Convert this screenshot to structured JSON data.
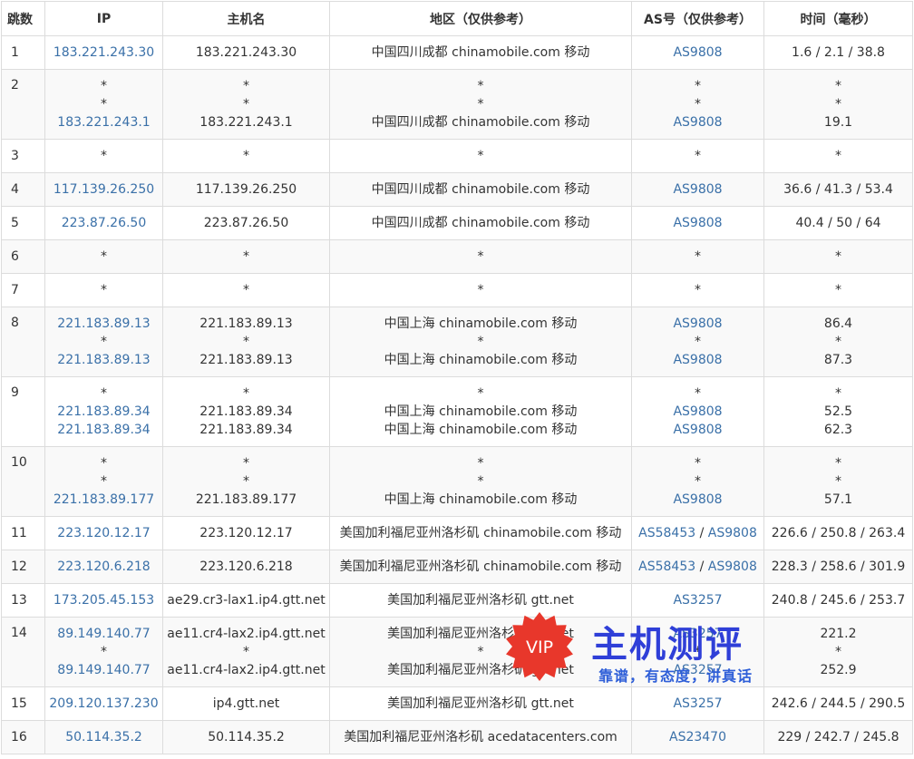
{
  "headers": [
    "跳数",
    "IP",
    "主机名",
    "地区（仅供参考）",
    "AS号（仅供参考）",
    "时间（毫秒）"
  ],
  "rows": [
    {
      "hop": "1",
      "lines": [
        {
          "ip": "183.221.243.30",
          "host": "183.221.243.30",
          "region": "中国四川成都 chinamobile.com 移动",
          "as": [
            "AS9808"
          ],
          "time": "1.6 / 2.1 / 38.8"
        }
      ]
    },
    {
      "hop": "2",
      "lines": [
        {
          "ip": "*",
          "host": "*",
          "region": "*",
          "as": [
            "*"
          ],
          "time": "*"
        },
        {
          "ip": "*",
          "host": "*",
          "region": "*",
          "as": [
            "*"
          ],
          "time": "*"
        },
        {
          "ip": "183.221.243.1",
          "host": "183.221.243.1",
          "region": "中国四川成都 chinamobile.com 移动",
          "as": [
            "AS9808"
          ],
          "time": "19.1"
        }
      ]
    },
    {
      "hop": "3",
      "lines": [
        {
          "ip": "*",
          "host": "*",
          "region": "*",
          "as": [
            "*"
          ],
          "time": "*"
        }
      ]
    },
    {
      "hop": "4",
      "lines": [
        {
          "ip": "117.139.26.250",
          "host": "117.139.26.250",
          "region": "中国四川成都 chinamobile.com 移动",
          "as": [
            "AS9808"
          ],
          "time": "36.6 / 41.3 / 53.4"
        }
      ]
    },
    {
      "hop": "5",
      "lines": [
        {
          "ip": "223.87.26.50",
          "host": "223.87.26.50",
          "region": "中国四川成都 chinamobile.com 移动",
          "as": [
            "AS9808"
          ],
          "time": "40.4 / 50 / 64"
        }
      ]
    },
    {
      "hop": "6",
      "lines": [
        {
          "ip": "*",
          "host": "*",
          "region": "*",
          "as": [
            "*"
          ],
          "time": "*"
        }
      ]
    },
    {
      "hop": "7",
      "lines": [
        {
          "ip": "*",
          "host": "*",
          "region": "*",
          "as": [
            "*"
          ],
          "time": "*"
        }
      ]
    },
    {
      "hop": "8",
      "lines": [
        {
          "ip": "221.183.89.13",
          "host": "221.183.89.13",
          "region": "中国上海 chinamobile.com 移动",
          "as": [
            "AS9808"
          ],
          "time": "86.4"
        },
        {
          "ip": "*",
          "host": "*",
          "region": "*",
          "as": [
            "*"
          ],
          "time": "*"
        },
        {
          "ip": "221.183.89.13",
          "host": "221.183.89.13",
          "region": "中国上海 chinamobile.com 移动",
          "as": [
            "AS9808"
          ],
          "time": "87.3"
        }
      ]
    },
    {
      "hop": "9",
      "lines": [
        {
          "ip": "*",
          "host": "*",
          "region": "*",
          "as": [
            "*"
          ],
          "time": "*"
        },
        {
          "ip": "221.183.89.34",
          "host": "221.183.89.34",
          "region": "中国上海 chinamobile.com 移动",
          "as": [
            "AS9808"
          ],
          "time": "52.5"
        },
        {
          "ip": "221.183.89.34",
          "host": "221.183.89.34",
          "region": "中国上海 chinamobile.com 移动",
          "as": [
            "AS9808"
          ],
          "time": "62.3"
        }
      ]
    },
    {
      "hop": "10",
      "lines": [
        {
          "ip": "*",
          "host": "*",
          "region": "*",
          "as": [
            "*"
          ],
          "time": "*"
        },
        {
          "ip": "*",
          "host": "*",
          "region": "*",
          "as": [
            "*"
          ],
          "time": "*"
        },
        {
          "ip": "221.183.89.177",
          "host": "221.183.89.177",
          "region": "中国上海 chinamobile.com 移动",
          "as": [
            "AS9808"
          ],
          "time": "57.1"
        }
      ]
    },
    {
      "hop": "11",
      "lines": [
        {
          "ip": "223.120.12.17",
          "host": "223.120.12.17",
          "region": "美国加利福尼亚州洛杉矶 chinamobile.com 移动",
          "as": [
            "AS58453",
            "AS9808"
          ],
          "time": "226.6 / 250.8 / 263.4"
        }
      ]
    },
    {
      "hop": "12",
      "lines": [
        {
          "ip": "223.120.6.218",
          "host": "223.120.6.218",
          "region": "美国加利福尼亚州洛杉矶 chinamobile.com 移动",
          "as": [
            "AS58453",
            "AS9808"
          ],
          "time": "228.3 / 258.6 / 301.9"
        }
      ]
    },
    {
      "hop": "13",
      "lines": [
        {
          "ip": "173.205.45.153",
          "host": "ae29.cr3-lax1.ip4.gtt.net",
          "region": "美国加利福尼亚州洛杉矶 gtt.net",
          "as": [
            "AS3257"
          ],
          "time": "240.8 / 245.6 / 253.7"
        }
      ]
    },
    {
      "hop": "14",
      "lines": [
        {
          "ip": "89.149.140.77",
          "host": "ae11.cr4-lax2.ip4.gtt.net",
          "region": "美国加利福尼亚州洛杉矶 gtt.net",
          "as": [
            "AS3257"
          ],
          "time": "221.2"
        },
        {
          "ip": "*",
          "host": "*",
          "region": "*",
          "as": [
            "*"
          ],
          "time": "*"
        },
        {
          "ip": "89.149.140.77",
          "host": "ae11.cr4-lax2.ip4.gtt.net",
          "region": "美国加利福尼亚州洛杉矶 gtt.net",
          "as": [
            "AS3257"
          ],
          "time": "252.9"
        }
      ]
    },
    {
      "hop": "15",
      "lines": [
        {
          "ip": "209.120.137.230",
          "host": "ip4.gtt.net",
          "region": "美国加利福尼亚州洛杉矶 gtt.net",
          "as": [
            "AS3257"
          ],
          "time": "242.6 / 244.5 / 290.5"
        }
      ]
    },
    {
      "hop": "16",
      "lines": [
        {
          "ip": "50.114.35.2",
          "host": "50.114.35.2",
          "region": "美国加利福尼亚州洛杉矶 acedatacenters.com",
          "as": [
            "AS23470"
          ],
          "time": "229 / 242.7 / 245.8"
        }
      ]
    }
  ],
  "watermark": {
    "badge": "VIP",
    "title": "主机测评",
    "subtitle": "靠谱，有态度，讲真话",
    "badge_color": "#e8372b",
    "title_color": "#2f3fd8"
  },
  "colors": {
    "link": "#3a70a8",
    "stripe": "#f9f9f9",
    "border": "#dcdcdc"
  }
}
